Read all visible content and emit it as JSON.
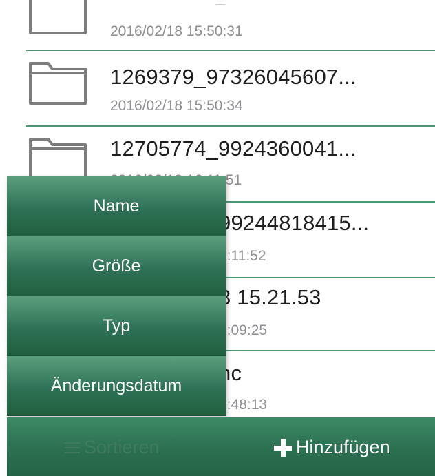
{
  "files": [
    {
      "name": "",
      "date": "2016/02/18 15:50:31"
    },
    {
      "name": "1269379_97326045607...",
      "date": "2016/02/18 15:50:34"
    },
    {
      "name": "12705774_9924360041...",
      "date": "2016/02/18 16:11:51"
    },
    {
      "name": "99244818415...",
      "date": "6:11:52"
    },
    {
      "name": "8 15.21.53",
      "date": "6:09:25"
    },
    {
      "name": "nc",
      "date": "1:48:13"
    }
  ],
  "sort_menu": {
    "items": [
      "Name",
      "Größe",
      "Typ",
      "Änderungsdatum"
    ]
  },
  "toolbar": {
    "sort_label": "Sortieren",
    "add_label": "Hinzufügen",
    "sort_icon": "list-icon",
    "add_icon": "plus-icon"
  },
  "colors": {
    "accent": "#2e7155",
    "separator": "#4a9a76"
  }
}
